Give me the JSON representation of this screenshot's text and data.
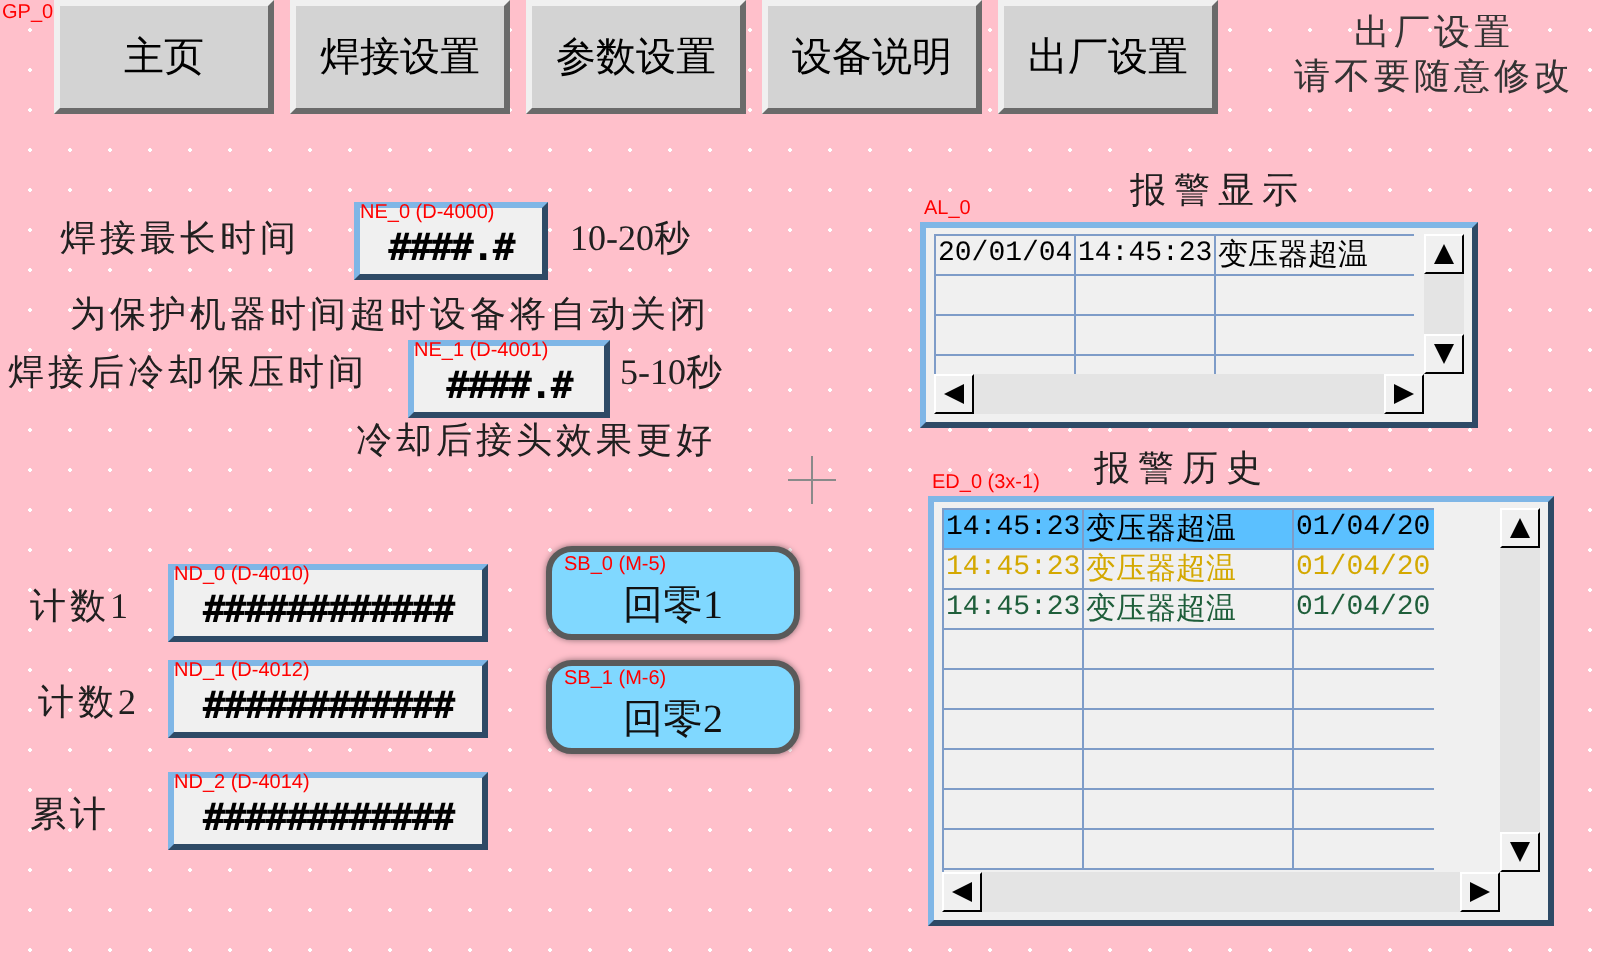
{
  "canvas_tag": "GP_0",
  "nav": [
    {
      "label": "主页"
    },
    {
      "label": "焊接设置"
    },
    {
      "label": "参数设置"
    },
    {
      "label": "设备说明"
    },
    {
      "label": "出厂设置"
    }
  ],
  "notice": [
    "出厂设置",
    "请不要随意修改"
  ],
  "settings": [
    {
      "label": "焊接最长时间",
      "tag": "NE_0 (D-4000)",
      "value": "####.#",
      "range": "10-20秒",
      "note": "为保护机器时间超时设备将自动关闭"
    },
    {
      "label": "焊接后冷却保压时间",
      "tag": "NE_1 (D-4001)",
      "value": "####.#",
      "range": "5-10秒",
      "note": "冷却后接头效果更好"
    }
  ],
  "counters": [
    {
      "label": "计数1",
      "tag": "ND_0 (D-4010)",
      "value": "############"
    },
    {
      "label": "计数2",
      "tag": "ND_1 (D-4012)",
      "value": "############"
    },
    {
      "label": "累计",
      "tag": "ND_2 (D-4014)",
      "value": "############"
    }
  ],
  "reset_buttons": [
    {
      "label": "回零1",
      "tag": "SB_0 (M-5)"
    },
    {
      "label": "回零2",
      "tag": "SB_1 (M-6)"
    }
  ],
  "alarm_display": {
    "title": "报警显示",
    "tag": "AL_0",
    "rows": [
      {
        "date": "20/01/04",
        "time": "14:45:23",
        "message": "变压器超温"
      }
    ]
  },
  "alarm_history": {
    "title": "报警历史",
    "tag": "ED_0 (3x-1)",
    "rows": [
      {
        "time": "14:45:23",
        "message": "变压器超温",
        "date": "01/04/20",
        "color": "#000000",
        "selected": true
      },
      {
        "time": "14:45:23",
        "message": "变压器超温",
        "date": "01/04/20",
        "color": "#d4a800",
        "selected": false
      },
      {
        "time": "14:45:23",
        "message": "变压器超温",
        "date": "01/04/20",
        "color": "#1e5e3a",
        "selected": false
      }
    ]
  }
}
